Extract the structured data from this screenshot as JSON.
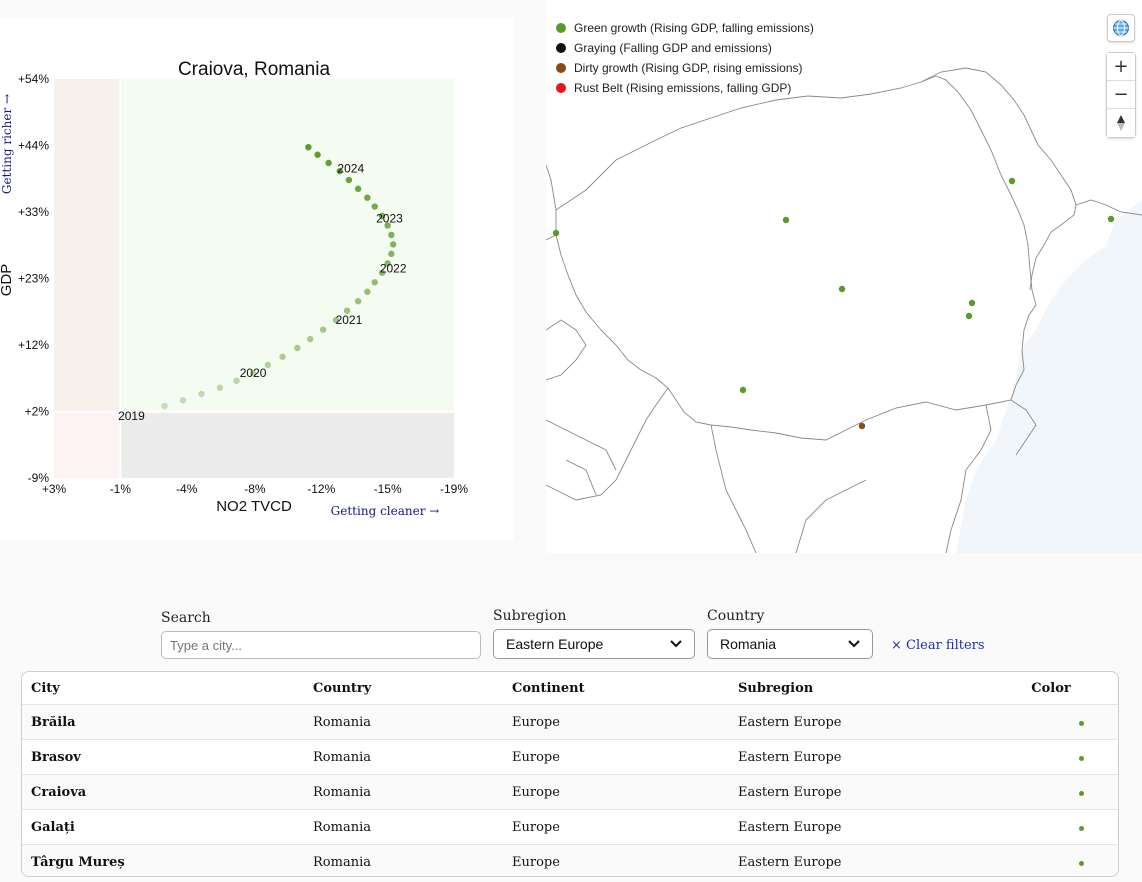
{
  "chart_data": {
    "type": "scatter",
    "title": "Craiova, Romania",
    "xlabel": "NO2 TVCD",
    "ylabel": "GDP",
    "x_annotation": "Getting cleaner →",
    "y_annotation": "Getting richer →",
    "x_ticks": [
      "+3%",
      "-1%",
      "-4%",
      "-8%",
      "-12%",
      "-15%",
      "-19%"
    ],
    "x_tick_values": [
      3,
      -0.6,
      -4.2,
      -7.9,
      -11.5,
      -15.1,
      -18.7
    ],
    "y_ticks": [
      "+54%",
      "+44%",
      "+33%",
      "+23%",
      "+12%",
      "+2%",
      "-9%"
    ],
    "y_tick_values": [
      54.3,
      43.8,
      33.2,
      22.7,
      12.2,
      1.6,
      -8.9
    ],
    "xlim": [
      3,
      -18.7
    ],
    "ylim": [
      -8.9,
      54.3
    ],
    "quadrants": [
      {
        "xmin": 3,
        "xmax": -0.6,
        "ymin": 1.6,
        "ymax": 54.3,
        "color": "#f6f1ea"
      },
      {
        "xmin": -0.6,
        "xmax": -18.7,
        "ymin": 1.6,
        "ymax": 54.3,
        "color": "#f4fbf1"
      },
      {
        "xmin": 3,
        "xmax": -0.6,
        "ymin": -8.9,
        "ymax": 1.6,
        "color": "#fdf3f3"
      },
      {
        "xmin": -0.6,
        "xmax": -18.7,
        "ymin": -8.9,
        "ymax": 1.6,
        "color": "#ececec"
      }
    ],
    "series": [
      {
        "color": "#5a9a2a",
        "x": [
          -3.0,
          -4.0,
          -5.0,
          -6.0,
          -6.9,
          -7.8,
          -8.6,
          -9.4,
          -10.2,
          -10.9,
          -11.6,
          -12.3,
          -12.9,
          -13.5,
          -14.0,
          -14.4,
          -14.8,
          -15.1,
          -15.3,
          -15.4,
          -15.3,
          -15.1,
          -14.8,
          -14.4,
          -14.0,
          -13.5,
          -13.0,
          -12.5,
          -11.9,
          -11.3,
          -10.8
        ],
        "y": [
          2.5,
          3.4,
          4.4,
          5.4,
          6.5,
          7.7,
          9.0,
          10.3,
          11.7,
          13.1,
          14.6,
          16.1,
          17.6,
          19.1,
          20.6,
          22.1,
          23.6,
          25.1,
          26.6,
          28.1,
          29.6,
          31.1,
          32.6,
          34.1,
          35.5,
          36.9,
          38.3,
          39.7,
          41.0,
          42.3,
          43.5
        ]
      }
    ],
    "year_labels": [
      {
        "label": "2019",
        "x": -1.2,
        "y": 0.9
      },
      {
        "label": "2020",
        "x": -7.8,
        "y": 7.7
      },
      {
        "label": "2021",
        "x": -13.0,
        "y": 16.1
      },
      {
        "label": "2022",
        "x": -15.4,
        "y": 24.3
      },
      {
        "label": "2023",
        "x": -15.2,
        "y": 32.2
      },
      {
        "label": "2024",
        "x": -13.1,
        "y": 40.1
      }
    ],
    "grid": false
  },
  "map": {
    "legend": [
      {
        "label": "Green growth (Rising GDP, falling emissions)",
        "color": "#5a9a2a"
      },
      {
        "label": "Graying (Falling GDP and emissions)",
        "color": "#111111"
      },
      {
        "label": "Dirty growth (Rising GDP, rising emissions)",
        "color": "#8b4a12"
      },
      {
        "label": "Rust Belt (Rising emissions, falling GDP)",
        "color": "#e8141c"
      }
    ],
    "controls": {
      "globe": "globe-icon",
      "zoom_in": "+",
      "zoom_out": "−",
      "compass": "compass-icon"
    },
    "sea_color": "#f1f6fa",
    "cities": [
      {
        "color": "#5a9a2a"
      },
      {
        "color": "#5a9a2a"
      },
      {
        "color": "#5a9a2a"
      },
      {
        "color": "#5a9a2a"
      },
      {
        "color": "#5a9a2a"
      },
      {
        "color": "#5a9a2a"
      },
      {
        "color": "#5a9a2a"
      },
      {
        "color": "#5a9a2a"
      },
      {
        "color": "#8b4a12"
      }
    ]
  },
  "filters": {
    "search_label": "Search",
    "search_placeholder": "Type a city...",
    "subregion_label": "Subregion",
    "subregion_value": "Eastern Europe",
    "country_label": "Country",
    "country_value": "Romania",
    "clear_label": "× Clear filters"
  },
  "table": {
    "columns": [
      "City",
      "Country",
      "Continent",
      "Subregion",
      "Color"
    ],
    "rows": [
      {
        "city": "Brăila",
        "country": "Romania",
        "continent": "Europe",
        "subregion": "Eastern Europe",
        "color": "#5a9a2a"
      },
      {
        "city": "Brasov",
        "country": "Romania",
        "continent": "Europe",
        "subregion": "Eastern Europe",
        "color": "#5a9a2a"
      },
      {
        "city": "Craiova",
        "country": "Romania",
        "continent": "Europe",
        "subregion": "Eastern Europe",
        "color": "#5a9a2a"
      },
      {
        "city": "Galați",
        "country": "Romania",
        "continent": "Europe",
        "subregion": "Eastern Europe",
        "color": "#5a9a2a"
      },
      {
        "city": "Târgu Mureș",
        "country": "Romania",
        "continent": "Europe",
        "subregion": "Eastern Europe",
        "color": "#5a9a2a"
      }
    ]
  }
}
